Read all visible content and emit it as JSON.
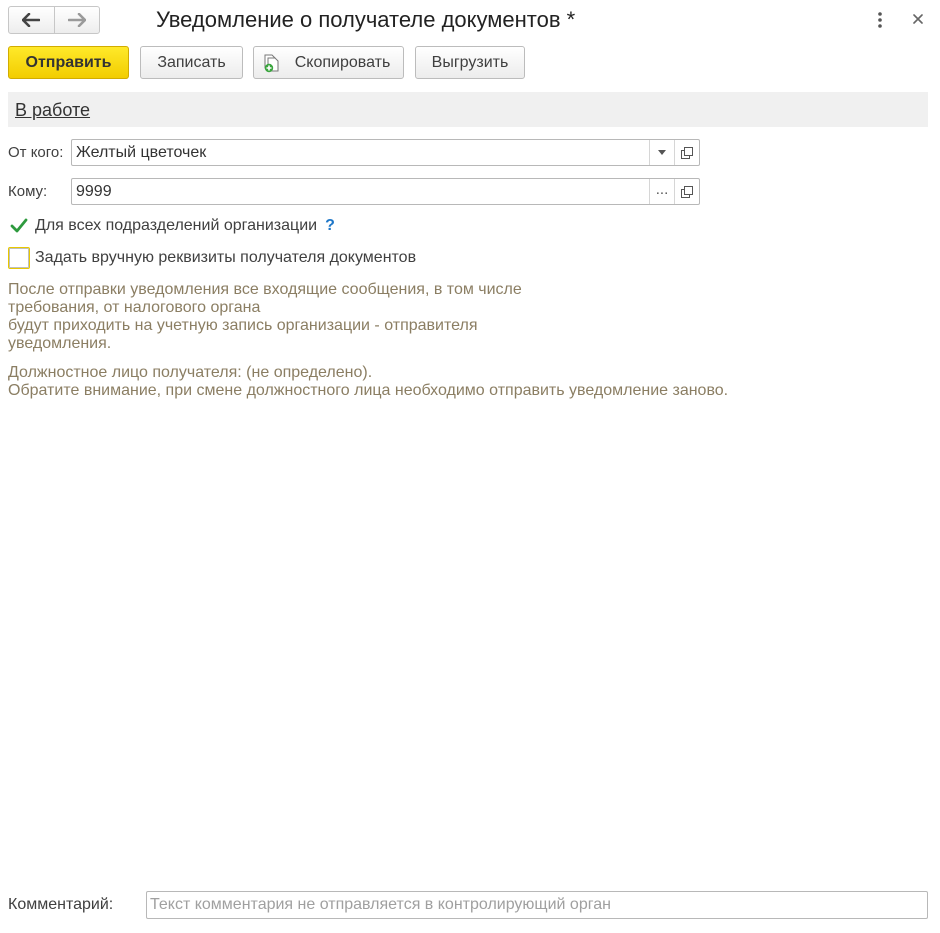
{
  "window": {
    "title": "Уведомление о получателе документов *"
  },
  "toolbar": {
    "send_label": "Отправить",
    "save_label": "Записать",
    "copy_label": "Скопировать",
    "upload_label": "Выгрузить"
  },
  "status": {
    "label": "В работе"
  },
  "form": {
    "from": {
      "label": "От кого:",
      "value": "Желтый цветочек"
    },
    "to": {
      "label": "Кому:",
      "value": "9999"
    },
    "all_divisions": {
      "label": "Для всех подразделений организации",
      "checked": true,
      "help": "?"
    },
    "manual_requisites": {
      "label": "Задать вручную реквизиты получателя документов",
      "checked": false
    }
  },
  "info": {
    "paragraph1": [
      "После отправки уведомления все входящие сообщения, в том числе",
      "требования, от налогового органа",
      "будут приходить на учетную запись организации - отправителя",
      "уведомления."
    ],
    "paragraph2": [
      "Должностное лицо получателя: (не определено).",
      "Обратите внимание, при смене должностного лица необходимо отправить уведомление заново."
    ]
  },
  "comment": {
    "label": "Комментарий:",
    "placeholder": "Текст комментария не отправляется в контролирующий орган",
    "value": ""
  },
  "icons": {
    "back": "arrow-left-icon",
    "forward": "arrow-right-icon",
    "more": "more-vertical-icon",
    "close": "close-icon",
    "copy": "copy-document-icon",
    "dropdown": "chevron-down-icon",
    "open": "open-form-icon",
    "select": "ellipsis-icon",
    "check": "checkmark-icon",
    "help": "help-icon"
  },
  "colors": {
    "primary_button": "#f5d400",
    "info_text": "#8b7e63",
    "check_green": "#2e9a3e",
    "help_blue": "#1f77c8",
    "status_bar": "#f0f0f0"
  }
}
